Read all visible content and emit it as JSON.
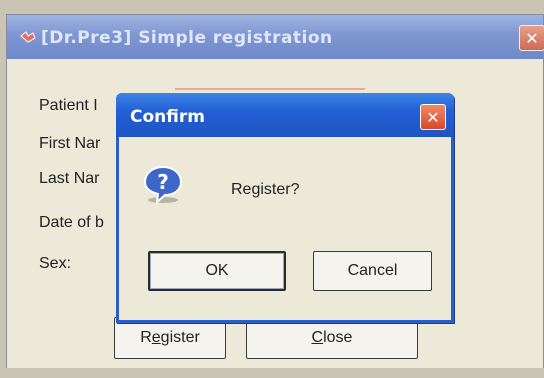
{
  "main_window": {
    "title": "[Dr.Pre3] Simple registration",
    "close_glyph": "✕",
    "form": {
      "patient_id_label": "Patient I",
      "first_name_label": "First Nar",
      "last_name_label": "Last Nar",
      "date_of_birth_label": "Date of b",
      "sex_label": "Sex:"
    },
    "buttons": {
      "register_prefix": "R",
      "register_mnemonic": "e",
      "register_suffix": "gister",
      "close_mnemonic": "C",
      "close_suffix": "lose"
    }
  },
  "confirm_dialog": {
    "title": "Confirm",
    "close_glyph": "✕",
    "message": "Register?",
    "icon": "question-icon",
    "ok_label": "OK",
    "cancel_label": "Cancel"
  },
  "colors": {
    "dialog_titlebar": "#2360d4",
    "main_titlebar_inactive": "#7f97d2",
    "close_button": "#d9482a",
    "window_face": "#ece9d8"
  }
}
